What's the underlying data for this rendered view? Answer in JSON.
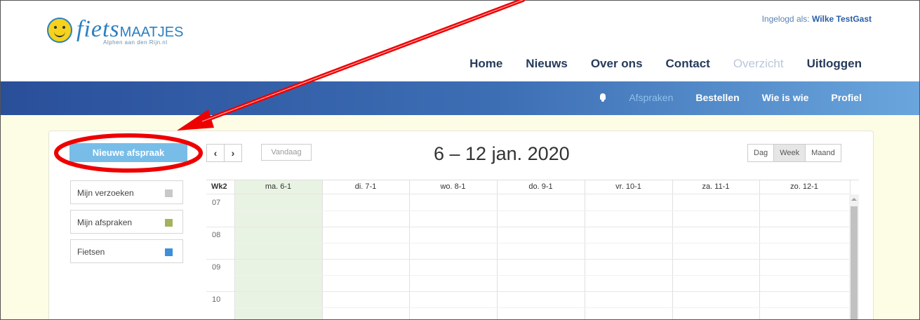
{
  "header": {
    "logo_main": "fiets",
    "logo_caps": "MAATJES",
    "logo_sub": "Alphen aan den Rijn.nl",
    "logged_in_label": "Ingelogd als:",
    "logged_in_user": "Wilke TestGast"
  },
  "topnav": [
    "Home",
    "Nieuws",
    "Over ons",
    "Contact",
    "Overzicht",
    "Uitloggen"
  ],
  "subnav": {
    "bell_icon": "bell-icon",
    "items": [
      "Afspraken",
      "Bestellen",
      "Wie is wie",
      "Profiel"
    ]
  },
  "sidebar": {
    "new_button": "Nieuwe afspraak",
    "calendars": [
      {
        "label": "Mijn verzoeken",
        "color": "#c8c8c8"
      },
      {
        "label": "Mijn afspraken",
        "color": "#a3b35c"
      },
      {
        "label": "Fietsen",
        "color": "#3c8fd8"
      }
    ]
  },
  "toolbar": {
    "prev": "‹",
    "next": "›",
    "today": "Vandaag",
    "title": "6 – 12 jan. 2020",
    "views": [
      "Dag",
      "Week",
      "Maand"
    ],
    "active_view": "Week"
  },
  "grid": {
    "week_label": "Wk2",
    "days": [
      "ma. 6-1",
      "di. 7-1",
      "wo. 8-1",
      "do. 9-1",
      "vr. 10-1",
      "za. 11-1",
      "zo. 12-1"
    ],
    "hours": [
      "07",
      "08",
      "09",
      "10"
    ]
  },
  "colors": {
    "brand_blue": "#2a4f9a",
    "accent": "#78bde8",
    "annotation": "#ee0000"
  }
}
